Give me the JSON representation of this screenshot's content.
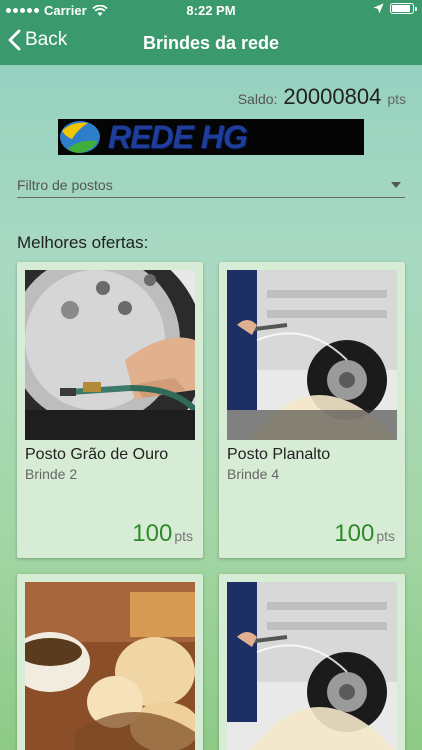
{
  "status_bar": {
    "carrier": "Carrier",
    "time": "8:22 PM",
    "battery_level": 0.9
  },
  "nav": {
    "back_label": "Back",
    "title": "Brindes da rede"
  },
  "saldo": {
    "label": "Saldo:",
    "value": "20000804",
    "unit": "pts"
  },
  "logo": {
    "text": "REDE HG"
  },
  "filter": {
    "placeholder": "Filtro de postos"
  },
  "section": {
    "title": "Melhores ofertas:"
  },
  "offers": [
    {
      "name": "Posto Grão de Ouro",
      "brinde": "Brinde 2",
      "points": "100",
      "unit": "pts",
      "image": "tire-inflation-photo"
    },
    {
      "name": "Posto Planalto",
      "brinde": "Brinde 4",
      "points": "100",
      "unit": "pts",
      "image": "truck-wash-photo"
    },
    {
      "name": "",
      "brinde": "",
      "points": "",
      "unit": "",
      "image": "coffee-bread-photo"
    },
    {
      "name": "",
      "brinde": "",
      "points": "",
      "unit": "",
      "image": "truck-wash-photo"
    }
  ],
  "colors": {
    "header": "#3a9a6e",
    "accent_points": "#2f8a2a",
    "card_bg": "#d7ecd5"
  }
}
